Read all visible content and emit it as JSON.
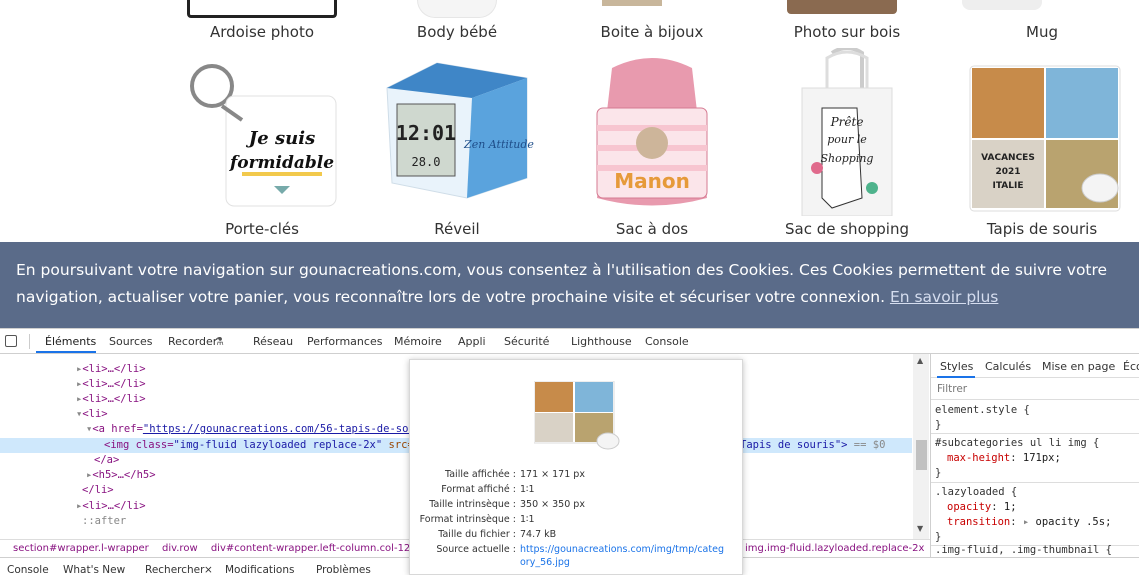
{
  "products_top": [
    {
      "label": "Ardoise photo"
    },
    {
      "label": "Body bébé"
    },
    {
      "label": "Boite à bijoux"
    },
    {
      "label": "Photo sur bois"
    },
    {
      "label": "Mug"
    }
  ],
  "products": [
    {
      "label": "Porte-clés",
      "icon": "keychain-image"
    },
    {
      "label": "Réveil",
      "icon": "alarm-clock-image"
    },
    {
      "label": "Sac à dos",
      "icon": "backpack-image"
    },
    {
      "label": "Sac de shopping",
      "icon": "tote-bag-image"
    },
    {
      "label": "Tapis de souris",
      "icon": "mousepad-image"
    }
  ],
  "product_images": {
    "keychain_line1": "Je suis",
    "keychain_line2": "formidable",
    "clock_time": "12:01",
    "clock_sub": "28.0",
    "clock_brand": "Zen Attitude",
    "backpack_name": "Manon",
    "tote_line1": "Prête",
    "tote_line2": "pour le",
    "tote_line3": "Shopping",
    "mousepad_line1": "VACANCES",
    "mousepad_line2": "2021",
    "mousepad_line3": "ITALIE"
  },
  "cookie": {
    "line1": "En poursuivant votre navigation sur gounacreations.com, vous consentez à l'utilisation des Cookies. Ces Cookies permettent de suivre votre",
    "line2": "navigation, actualiser votre panier, vous reconnaître lors de votre prochaine visite et sécuriser votre connexion.",
    "link": "En savoir plus"
  },
  "devtools": {
    "tabs": [
      "Éléments",
      "Sources",
      "Recorder",
      "Réseau",
      "Performances",
      "Mémoire",
      "Appli",
      "Sécurité",
      "Lighthouse",
      "Console"
    ],
    "dom": {
      "l0": "<li>…</li>",
      "l1": "<li>…</li>",
      "l2": "<li>…</li>",
      "l3": "<li>",
      "a_open": "<a href=",
      "a_href": "\"https://gounacreations.com/56-tapis-de-souris",
      "img_open": "<img class=",
      "img_class": "\"img-fluid lazyloaded replace-2x\"",
      "img_src": " src=\"ht",
      "img_tail": "Tapis de souris\">",
      "img_eq": " == $0",
      "a_close": "</a>",
      "h5": "<h5>…</h5>",
      "li_close": "</li>",
      "l_next": "<li>…</li>",
      "after": "::after"
    },
    "breadcrumb": [
      "section#wrapper.l-wrapper",
      "div.row",
      "div#content-wrapper.left-column.col-12.col-l",
      "img.img-fluid.lazyloaded.replace-2x"
    ],
    "drawer": [
      "Console",
      "What's New",
      "Rechercher",
      "Modifications",
      "Problèmes"
    ],
    "drawer_close": "×",
    "styles_tabs": [
      "Styles",
      "Calculés",
      "Mise en page",
      "Éco"
    ],
    "filter_placeholder": "Filtrer",
    "rules": {
      "r1_sel": "element.style {",
      "r1_end": "}",
      "r2_sel": "#subcategories ul li img {",
      "r2_prop": "max-height",
      "r2_val": "171px;",
      "r2_end": "}",
      "r3_sel": ".lazyloaded {",
      "r3_p1": "opacity",
      "r3_v1": "1;",
      "r3_p2": "transition",
      "r3_v2": "opacity .5s;",
      "r3_end": "}",
      "r4_sel": ".img-fluid, .img-thumbnail {"
    },
    "tooltip": {
      "rows": [
        {
          "k": "Taille affichée :",
          "v": "171 × 171 px"
        },
        {
          "k": "Format affiché :",
          "v": "1∶1"
        },
        {
          "k": "Taille intrinsèque :",
          "v": "350 × 350 px"
        },
        {
          "k": "Format intrinsèque :",
          "v": "1∶1"
        },
        {
          "k": "Taille du fichier :",
          "v": "74.7 kB"
        },
        {
          "k": "Source actuelle :",
          "v": "https://gounacreations.com/img/tmp/categ"
        }
      ],
      "src_line2": "ory_56.jpg"
    }
  }
}
